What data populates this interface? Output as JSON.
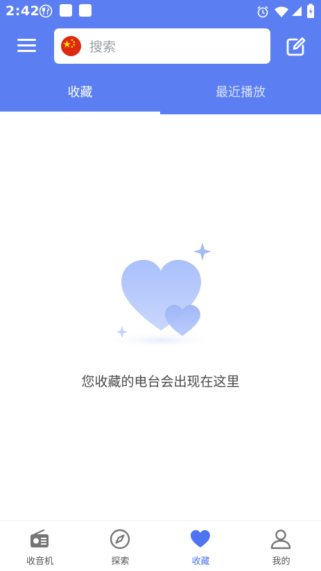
{
  "status_bar": {
    "time": "2:42",
    "left_icons": [
      "fork-knife-icon",
      "app-square-icon",
      "app-square-icon"
    ],
    "right_icons": [
      "alarm-icon",
      "wifi-icon",
      "signal-icon",
      "battery-icon"
    ]
  },
  "header": {
    "menu_icon": "hamburger-menu-icon",
    "search": {
      "placeholder": "搜索",
      "flag": "china-flag-icon"
    },
    "edit_icon": "edit-icon"
  },
  "tabs": [
    {
      "label": "收藏",
      "active": true
    },
    {
      "label": "最近播放",
      "active": false
    }
  ],
  "empty_state": {
    "illustration": "hearts-illustration",
    "message": "您收藏的电台会出现在这里"
  },
  "bottom_nav": [
    {
      "label": "收音机",
      "icon": "radio-icon",
      "active": false
    },
    {
      "label": "探索",
      "icon": "compass-icon",
      "active": false
    },
    {
      "label": "收藏",
      "icon": "heart-icon",
      "active": true
    },
    {
      "label": "我的",
      "icon": "user-icon",
      "active": false
    }
  ],
  "colors": {
    "primary": "#5b7ff3",
    "active_nav": "#4f74f0",
    "inactive_nav": "#555555",
    "text_muted": "#9aa0a6",
    "flag_red": "#de2910",
    "flag_yellow": "#ffde00"
  }
}
